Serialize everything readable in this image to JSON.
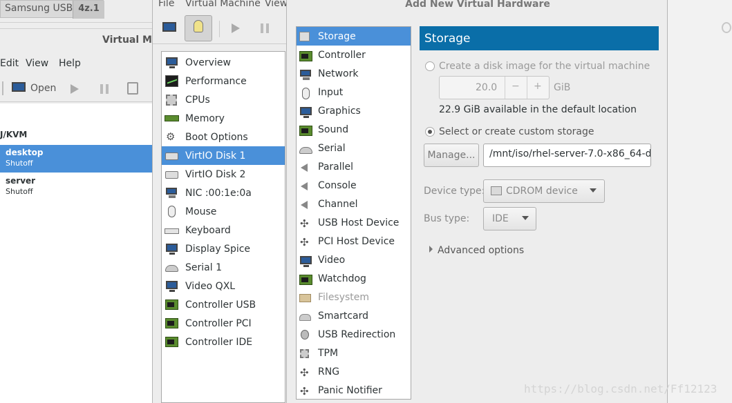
{
  "background_window": {
    "tab_label": "Samsung USB",
    "tab_badge": "4z.1",
    "title": "Virtual M",
    "menu": [
      "Edit",
      "View",
      "Help"
    ],
    "toolbar_open_label": "Open",
    "connection_label": "J/KVM",
    "vms": [
      {
        "name": "desktop",
        "status": "Shutoff"
      },
      {
        "name": "server",
        "status": "Shutoff"
      }
    ]
  },
  "details_window": {
    "menu": [
      "File",
      "Virtual Machine",
      "View"
    ],
    "hardware": [
      {
        "label": "Overview",
        "icon": "monitor-icon"
      },
      {
        "label": "Performance",
        "icon": "performance-icon"
      },
      {
        "label": "CPUs",
        "icon": "cpu-icon"
      },
      {
        "label": "Memory",
        "icon": "memory-icon"
      },
      {
        "label": "Boot Options",
        "icon": "gear-icon"
      },
      {
        "label": "VirtIO Disk 1",
        "icon": "disk-icon"
      },
      {
        "label": "VirtIO Disk 2",
        "icon": "disk-icon"
      },
      {
        "label": "NIC :00:1e:0a",
        "icon": "network-icon"
      },
      {
        "label": "Mouse",
        "icon": "mouse-icon"
      },
      {
        "label": "Keyboard",
        "icon": "keyboard-icon"
      },
      {
        "label": "Display Spice",
        "icon": "monitor-icon"
      },
      {
        "label": "Serial 1",
        "icon": "serial-icon"
      },
      {
        "label": "Video QXL",
        "icon": "monitor-icon"
      },
      {
        "label": "Controller USB",
        "icon": "controller-icon"
      },
      {
        "label": "Controller PCI",
        "icon": "controller-icon"
      },
      {
        "label": "Controller IDE",
        "icon": "controller-icon"
      }
    ],
    "selected_index": 5
  },
  "dialog": {
    "title": "Add New Virtual Hardware",
    "types": [
      {
        "label": "Storage",
        "icon": "storage-icon",
        "disabled": false
      },
      {
        "label": "Controller",
        "icon": "controller-icon",
        "disabled": false
      },
      {
        "label": "Network",
        "icon": "network-icon",
        "disabled": false
      },
      {
        "label": "Input",
        "icon": "mouse-icon",
        "disabled": false
      },
      {
        "label": "Graphics",
        "icon": "monitor-icon",
        "disabled": false
      },
      {
        "label": "Sound",
        "icon": "sound-card-icon",
        "disabled": false
      },
      {
        "label": "Serial",
        "icon": "serial-icon",
        "disabled": false
      },
      {
        "label": "Parallel",
        "icon": "parallel-icon",
        "disabled": false
      },
      {
        "label": "Console",
        "icon": "console-icon",
        "disabled": false
      },
      {
        "label": "Channel",
        "icon": "channel-icon",
        "disabled": false
      },
      {
        "label": "USB Host Device",
        "icon": "usb-icon",
        "disabled": false
      },
      {
        "label": "PCI Host Device",
        "icon": "pci-icon",
        "disabled": false
      },
      {
        "label": "Video",
        "icon": "monitor-icon",
        "disabled": false
      },
      {
        "label": "Watchdog",
        "icon": "watchdog-icon",
        "disabled": false
      },
      {
        "label": "Filesystem",
        "icon": "folder-icon",
        "disabled": true
      },
      {
        "label": "Smartcard",
        "icon": "smartcard-icon",
        "disabled": false
      },
      {
        "label": "USB Redirection",
        "icon": "usb-redirection-icon",
        "disabled": false
      },
      {
        "label": "TPM",
        "icon": "tpm-icon",
        "disabled": false
      },
      {
        "label": "RNG",
        "icon": "rng-icon",
        "disabled": false
      },
      {
        "label": "Panic Notifier",
        "icon": "panic-icon",
        "disabled": false
      }
    ],
    "selected_index": 0,
    "storage": {
      "header": "Storage",
      "create_disk_label": "Create a disk image for the virtual machine",
      "disk_size_value": "20.0",
      "minus_label": "−",
      "plus_label": "+",
      "size_unit": "GiB",
      "available_text": "22.9 GiB available in the default location",
      "custom_storage_label": "Select or create custom storage",
      "manage_button": "Manage...",
      "path_value": "/mnt/iso/rhel-server-7.0-x86_64-d",
      "device_type_label": "Device type:",
      "device_type_value": "CDROM device",
      "bus_type_label": "Bus type:",
      "bus_type_value": "IDE",
      "advanced_label": "Advanced options"
    }
  },
  "watermark": "https://blog.csdn.net/Ff12123"
}
